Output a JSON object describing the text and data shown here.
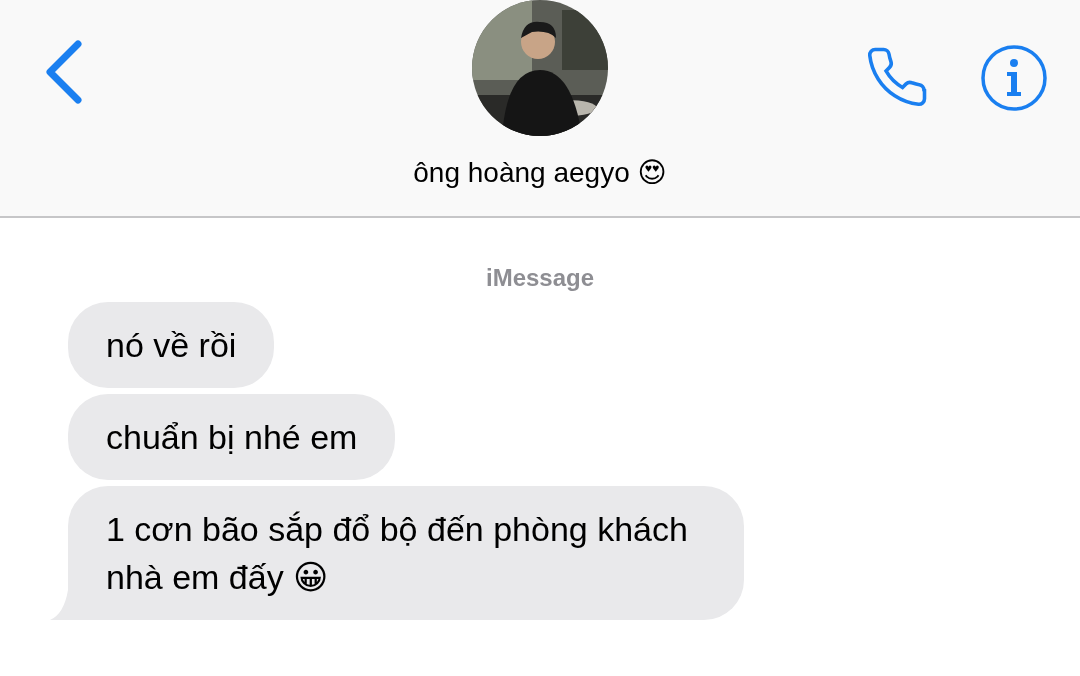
{
  "header": {
    "contact_name": "ông hoàng aegyo 😍"
  },
  "service_label": "iMessage",
  "messages": [
    {
      "text": "nó về rồi",
      "tail": false
    },
    {
      "text": "chuẩn bị nhé em",
      "tail": false
    },
    {
      "text": "1 cơn bão sắp đổ bộ đến phòng khách nhà em đấy 😀",
      "tail": true
    }
  ]
}
